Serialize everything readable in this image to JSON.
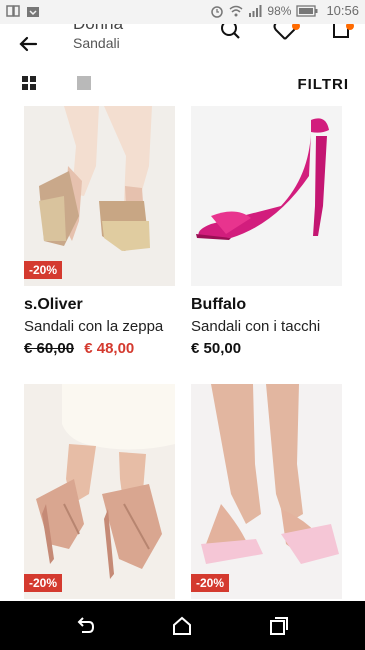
{
  "status_bar": {
    "battery_percent": "98%",
    "time": "10:56",
    "icons": [
      "app-icon",
      "download-icon",
      "alarm-icon",
      "wifi-icon",
      "signal-icon",
      "battery-icon"
    ]
  },
  "header": {
    "title": "Donna",
    "subtitle": "Sandali",
    "icons": [
      "back-arrow-icon",
      "search-icon",
      "heart-icon",
      "bag-icon"
    ]
  },
  "toolbar": {
    "filter_label": "FILTRI",
    "icons": [
      "grid-view-icon",
      "single-view-icon"
    ]
  },
  "products": [
    {
      "brand": "s.Oliver",
      "name": "Sandali con la zeppa",
      "old_price": "€ 60,00",
      "price": "€ 48,00",
      "discount": "-20%"
    },
    {
      "brand": "Buffalo",
      "name": "Sandali con i tacchi",
      "price": "€ 50,00"
    },
    {
      "discount": "-20%"
    },
    {
      "discount": "-20%"
    }
  ],
  "colors": {
    "accent_sale": "#d43a2f",
    "badge": "#ff6a00",
    "fuchsia_shoe": "#d21d7d"
  },
  "nav_bar": {
    "icons": [
      "back-icon",
      "home-icon",
      "recent-apps-icon"
    ]
  }
}
